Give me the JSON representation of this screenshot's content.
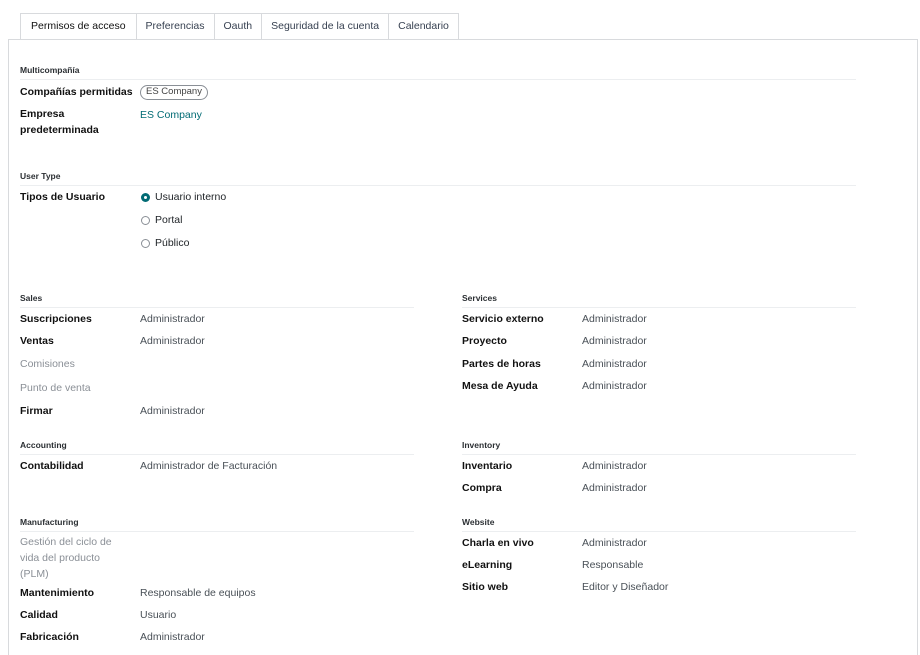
{
  "tabs": [
    {
      "label": "Permisos de acceso",
      "active": true
    },
    {
      "label": "Preferencias",
      "active": false
    },
    {
      "label": "Oauth",
      "active": false
    },
    {
      "label": "Seguridad de la cuenta",
      "active": false
    },
    {
      "label": "Calendario",
      "active": false
    }
  ],
  "multicompany": {
    "title": "Multicompañía",
    "allowed_label": "Compañías permitidas",
    "allowed_tag": "ES Company",
    "default_label_1": "Empresa",
    "default_label_2": "predeterminada",
    "default_value": "ES Company"
  },
  "user_type": {
    "title": "User Type",
    "label": "Tipos de Usuario",
    "options": [
      "Usuario interno",
      "Portal",
      "Público"
    ]
  },
  "sales": {
    "title": "Sales",
    "rows": [
      {
        "label": "Suscripciones",
        "value": "Administrador"
      },
      {
        "label": "Ventas",
        "value": "Administrador"
      },
      {
        "label": "Comisiones",
        "value": ""
      },
      {
        "label": "Punto de venta",
        "value": ""
      },
      {
        "label": "Firmar",
        "value": "Administrador"
      }
    ]
  },
  "services": {
    "title": "Services",
    "rows": [
      {
        "label": "Servicio externo",
        "value": "Administrador"
      },
      {
        "label": "Proyecto",
        "value": "Administrador"
      },
      {
        "label": "Partes de horas",
        "value": "Administrador"
      },
      {
        "label": "Mesa de Ayuda",
        "value": "Administrador"
      }
    ]
  },
  "accounting": {
    "title": "Accounting",
    "rows": [
      {
        "label": "Contabilidad",
        "value": "Administrador de Facturación"
      }
    ]
  },
  "inventory": {
    "title": "Inventory",
    "rows": [
      {
        "label": "Inventario",
        "value": "Administrador"
      },
      {
        "label": "Compra",
        "value": "Administrador"
      }
    ]
  },
  "manufacturing": {
    "title": "Manufacturing",
    "plm_label_1": "Gestión del ciclo de",
    "plm_label_2": "vida del producto",
    "plm_label_3": "(PLM)",
    "rows": [
      {
        "label": "Mantenimiento",
        "value": "Responsable de equipos"
      },
      {
        "label": "Calidad",
        "value": "Usuario"
      },
      {
        "label": "Fabricación",
        "value": "Administrador"
      }
    ]
  },
  "website": {
    "title": "Website",
    "rows": [
      {
        "label": "Charla en vivo",
        "value": "Administrador"
      },
      {
        "label": "eLearning",
        "value": "Responsable"
      },
      {
        "label": "Sitio web",
        "value": "Editor y Diseñador"
      }
    ]
  },
  "colors": {
    "accent": "#016b74",
    "muted": "#8a8f96"
  }
}
